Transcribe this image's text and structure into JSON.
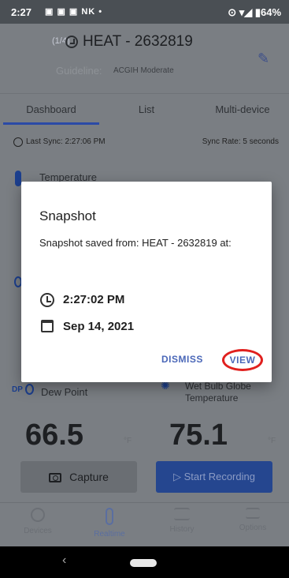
{
  "status_bar": {
    "time": "2:27",
    "notifications": "▣ ▣ ▣ NK •",
    "system": "⊙ ▾◢ ▮64%"
  },
  "header": {
    "device_number": "(1/4)",
    "title": "HEAT - 2632819",
    "guideline_label": "Guideline:",
    "guideline_value": "ACGIH Moderate"
  },
  "tabs": [
    "Dashboard",
    "List",
    "Multi-device"
  ],
  "sync": {
    "last_sync": "Last Sync: 2:27:06 PM",
    "sync_rate": "Sync Rate: 5 seconds"
  },
  "readings": {
    "temperature_label": "Temperature",
    "dew_point_tag": "DP",
    "dew_point_label": "Dew Point",
    "dew_point_value": "66.5",
    "dew_point_unit": "°F",
    "wbgt_label": "Wet Bulb Globe Temperature",
    "wbgt_value": "75.1",
    "wbgt_unit": "°F"
  },
  "buttons": {
    "capture": "Capture",
    "start_recording": "▷  Start Recording"
  },
  "bottom_nav": [
    "Devices",
    "Realtime",
    "History",
    "Options"
  ],
  "dialog": {
    "title": "Snapshot",
    "message": "Snapshot saved from: HEAT - 2632819 at:",
    "time": "2:27:02 PM",
    "date": "Sep 14, 2021",
    "dismiss": "DISMISS",
    "view": "VIEW"
  },
  "colors": {
    "accent": "#2b4aa6",
    "highlight_circle": "#e0201e",
    "dialog_button": "#4a67b8"
  }
}
